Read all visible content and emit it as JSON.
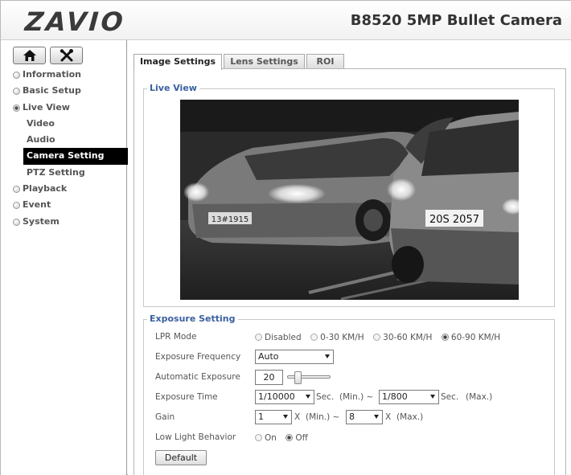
{
  "header": {
    "logo": "ZAVIO",
    "title": "B8520 5MP Bullet Camera"
  },
  "sidebar": {
    "items": [
      {
        "label": "Information"
      },
      {
        "label": "Basic Setup"
      },
      {
        "label": "Live View"
      },
      {
        "label": "Playback"
      },
      {
        "label": "Event"
      },
      {
        "label": "System"
      }
    ],
    "sub": [
      {
        "label": "Video"
      },
      {
        "label": "Audio"
      },
      {
        "label": "Camera Setting"
      },
      {
        "label": "PTZ Setting"
      }
    ]
  },
  "tabs": [
    {
      "label": "Image Settings"
    },
    {
      "label": "Lens Settings"
    },
    {
      "label": "ROI"
    }
  ],
  "live_view": {
    "legend": "Live View",
    "plates": [
      "13#1915",
      "20S 2057"
    ]
  },
  "exposure": {
    "legend": "Exposure Setting",
    "lpr_mode": {
      "label": "LPR Mode",
      "options": [
        "Disabled",
        "0-30 KM/H",
        "30-60 KM/H",
        "60-90 KM/H"
      ],
      "selected": "60-90 KM/H"
    },
    "frequency": {
      "label": "Exposure Frequency",
      "value": "Auto"
    },
    "auto_exposure": {
      "label": "Automatic Exposure",
      "value": "20",
      "level": 0.2
    },
    "time": {
      "label": "Exposure Time",
      "min": "1/10000",
      "max": "1/800",
      "unit": "Sec.",
      "min_txt": "(Min.) ~",
      "max_txt": "(Max.)"
    },
    "gain": {
      "label": "Gain",
      "min": "1",
      "max": "8",
      "unit": "X",
      "min_txt": "(Min.) ~",
      "max_txt": "(Max.)"
    },
    "low_light": {
      "label": "Low Light Behavior",
      "options": [
        "On",
        "Off"
      ],
      "selected": "Off"
    },
    "default_button": "Default"
  }
}
